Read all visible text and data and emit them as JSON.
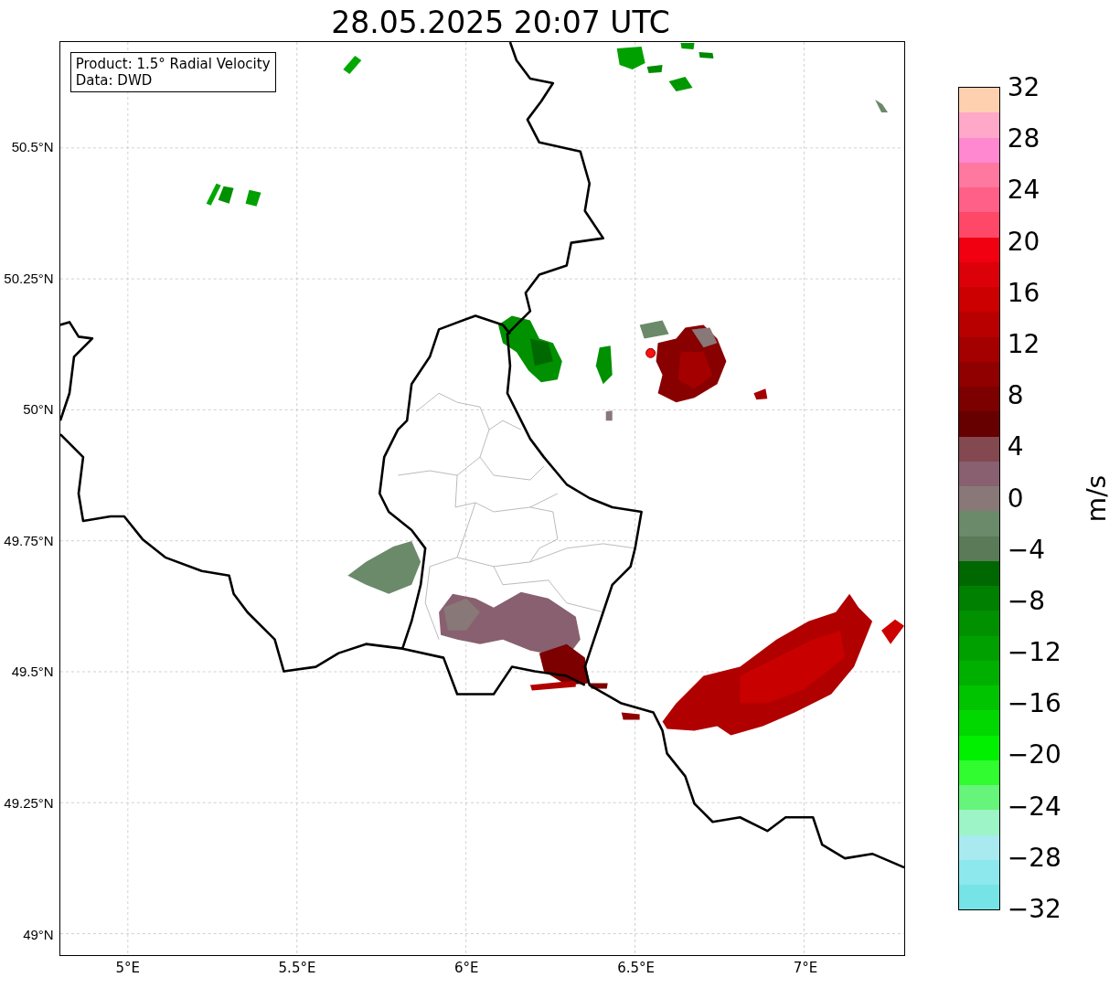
{
  "title": "28.05.2025 20:07 UTC",
  "legend": {
    "lines": [
      "Product: 1.5° Radial Velocity",
      "Data: DWD"
    ]
  },
  "map": {
    "lat_ticks": [
      "50.5°N",
      "50.25°N",
      "50°N",
      "49.75°N",
      "49.5°N",
      "49.25°N",
      "49°N"
    ],
    "lon_ticks": [
      "5°E",
      "5.5°E",
      "6°E",
      "6.5°E",
      "7°E"
    ]
  },
  "colorbar": {
    "label": "m/s",
    "ticks": [
      "32",
      "28",
      "24",
      "20",
      "16",
      "12",
      "8",
      "4",
      "0",
      "−4",
      "−8",
      "−12",
      "−16",
      "−20",
      "−24",
      "−28",
      "−32"
    ],
    "bands": [
      {
        "color": "#ffd0b0"
      },
      {
        "color": "#ffa8c8"
      },
      {
        "color": "#ff88d0"
      },
      {
        "color": "#ff78a0"
      },
      {
        "color": "#ff6088"
      },
      {
        "color": "#ff4868"
      },
      {
        "color": "#f00010"
      },
      {
        "color": "#dc0008"
      },
      {
        "color": "#cc0000"
      },
      {
        "color": "#b80000"
      },
      {
        "color": "#a40000"
      },
      {
        "color": "#900000"
      },
      {
        "color": "#7c0000"
      },
      {
        "color": "#660000"
      },
      {
        "color": "#844850"
      },
      {
        "color": "#886070"
      },
      {
        "color": "#887878"
      },
      {
        "color": "#6a8a6a"
      },
      {
        "color": "#5a7a58"
      },
      {
        "color": "#006800"
      },
      {
        "color": "#008000"
      },
      {
        "color": "#009000"
      },
      {
        "color": "#00a000"
      },
      {
        "color": "#00b000"
      },
      {
        "color": "#00c400"
      },
      {
        "color": "#00d800"
      },
      {
        "color": "#00f000"
      },
      {
        "color": "#30fc30"
      },
      {
        "color": "#66f47a"
      },
      {
        "color": "#9df4c6"
      },
      {
        "color": "#a8eaf0"
      },
      {
        "color": "#8ce8ec"
      },
      {
        "color": "#76e3e6"
      }
    ]
  }
}
